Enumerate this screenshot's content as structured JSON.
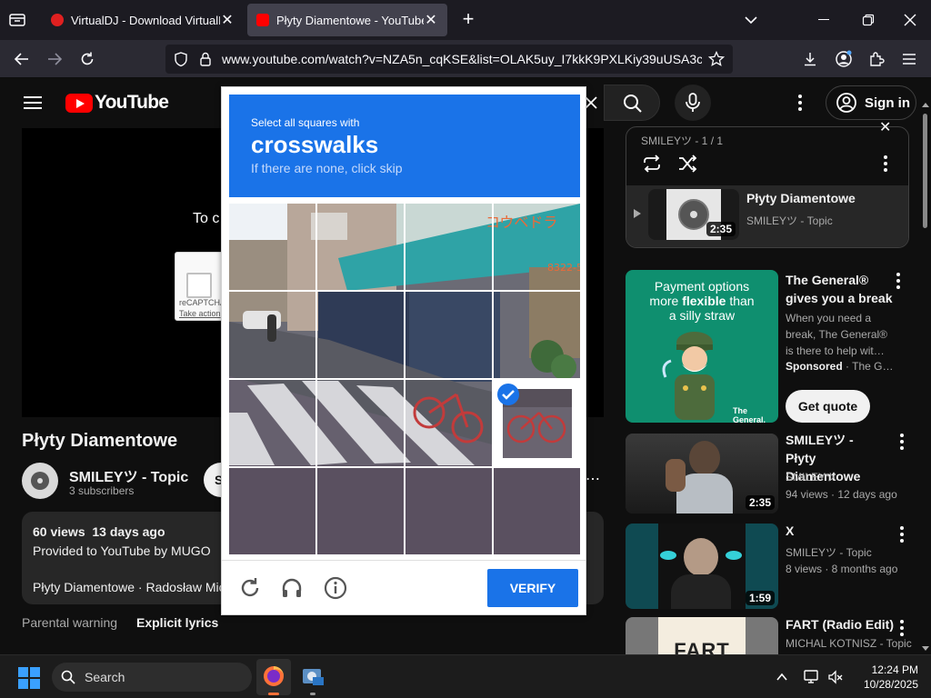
{
  "browser": {
    "tabs": [
      {
        "title": "VirtualDJ - Download VirtualDJ",
        "active": false,
        "favicon_color": "#e02020"
      },
      {
        "title": "Płyty Diamentowe - YouTube",
        "active": true,
        "favicon_color": "#ff0000"
      }
    ],
    "url": "www.youtube.com/watch?v=NZA5n_cqKSE&list=OLAK5uy_I7kkK9PXLKiy39uUSA3ctGPv"
  },
  "youtube": {
    "logo_text": "YouTube",
    "sign_in": "Sign in",
    "player_overlay_fragment": "To c",
    "recaptcha_fragment": "reCAPTCHA",
    "recaptcha_action_fragment": "Take action",
    "video_title": "Płyty Diamentowe",
    "channel_name": "SMILEYツ - Topic",
    "subscribers": "3 subscribers",
    "subscribe_fragment": "S",
    "description": {
      "stats": "60 views  13 days ago",
      "line1": "Provided to YouTube by MUGO",
      "line2": "Płyty Diamentowe · Radosław Mic"
    },
    "parental_warning": "Parental warning",
    "explicit_lyrics": "Explicit lyrics",
    "playlist": {
      "header": "SMILEYツ - 1 / 1",
      "item_title": "Płyty Diamentowe",
      "item_channel": "SMILEYツ - Topic",
      "item_duration": "2:35"
    },
    "ad": {
      "image_text_a": "Payment options",
      "image_text_b": "more",
      "image_text_bold": "flexible",
      "image_text_c": "than",
      "image_text_d": "a silly straw",
      "brand_logo": "The General.",
      "title": "The General® gives you a break",
      "desc": "When you need a break, The General® is there to help wit…",
      "sponsored": "Sponsored",
      "sponsor_name": "· The G…",
      "cta": "Get quote"
    },
    "recommendations": [
      {
        "title": "SMILEYツ - Płyty Diamentowe",
        "channel": "SMILEYツ",
        "meta": "94 views · 12 days ago",
        "duration": "2:35"
      },
      {
        "title": "X",
        "channel": "SMILEYツ - Topic",
        "meta": "8 views · 8 months ago",
        "duration": "1:59"
      },
      {
        "title": "FART (Radio Edit)",
        "channel": "MICHAL KOTNISZ - Topic",
        "meta": "",
        "thumb_text": "FART"
      }
    ]
  },
  "captcha": {
    "prompt_small": "Select all squares with",
    "prompt_big": "crosswalks",
    "prompt_hint": "If there are none, click skip",
    "storefront_sign": "コウベドラ",
    "storefront_phone": "8322-56",
    "verify_label": "VERIFY",
    "selected_cell": 11
  },
  "taskbar": {
    "search_label": "Search",
    "time": "12:24 PM",
    "date": "10/28/2025"
  }
}
